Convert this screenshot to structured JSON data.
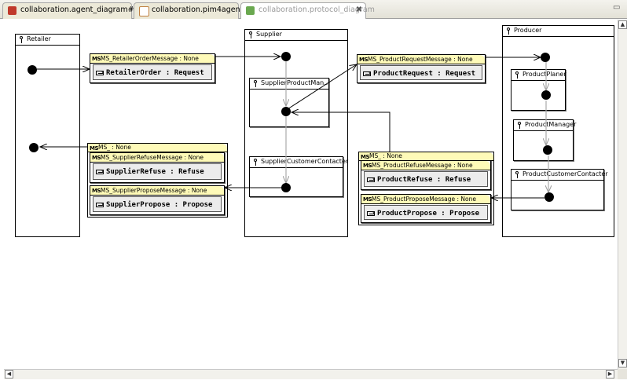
{
  "tabs": [
    {
      "label": "collaboration.agent_diagram#1",
      "icon": "diagram-icon",
      "active": false
    },
    {
      "label": "collaboration.pim4agents",
      "icon": "model-icon",
      "active": false
    },
    {
      "label": "collaboration.protocol_diagram",
      "icon": "protocol-icon",
      "active": true
    }
  ],
  "window": {
    "minimize": "▭",
    "maximize": "▭"
  },
  "agents": {
    "retailer": "Retailer",
    "supplier": "Supplier",
    "producer": "Producer"
  },
  "roles": {
    "supplier_product_manager": "SupplierProductMan...",
    "supplier_customer_contacter": "SupplierCustomerContacter",
    "product_planer": "ProductPlaner",
    "product_manager": "ProductManager",
    "product_customer_contacter": "ProductCustomerContacter"
  },
  "messages": {
    "retailer_order": {
      "header": "MS_RetailerOrderMessage : None",
      "body": "RetailerOrder : Request"
    },
    "product_request": {
      "header": "MS_ProductRequestMessage : None",
      "body": "ProductRequest : Request"
    },
    "supplier_group": {
      "header": "MS_ : None"
    },
    "supplier_refuse": {
      "header": "MS_SupplierRefuseMessage : None",
      "body": "SupplierRefuse : Refuse"
    },
    "supplier_propose": {
      "header": "MS_SupplierProposeMessage : None",
      "body": "SupplierPropose : Propose"
    },
    "product_group": {
      "header": "MS_ : None"
    },
    "product_refuse": {
      "header": "MS_ProductRefuseMessage : None",
      "body": "ProductRefuse : Refuse"
    },
    "product_propose": {
      "header": "MS_ProductProposeMessage : None",
      "body": "ProductPropose : Propose"
    }
  },
  "ms_badge": "MS",
  "colors": {
    "message_header": "#fefab8",
    "message_body": "#ececec",
    "active_tab_text": "#9a9a9a"
  }
}
